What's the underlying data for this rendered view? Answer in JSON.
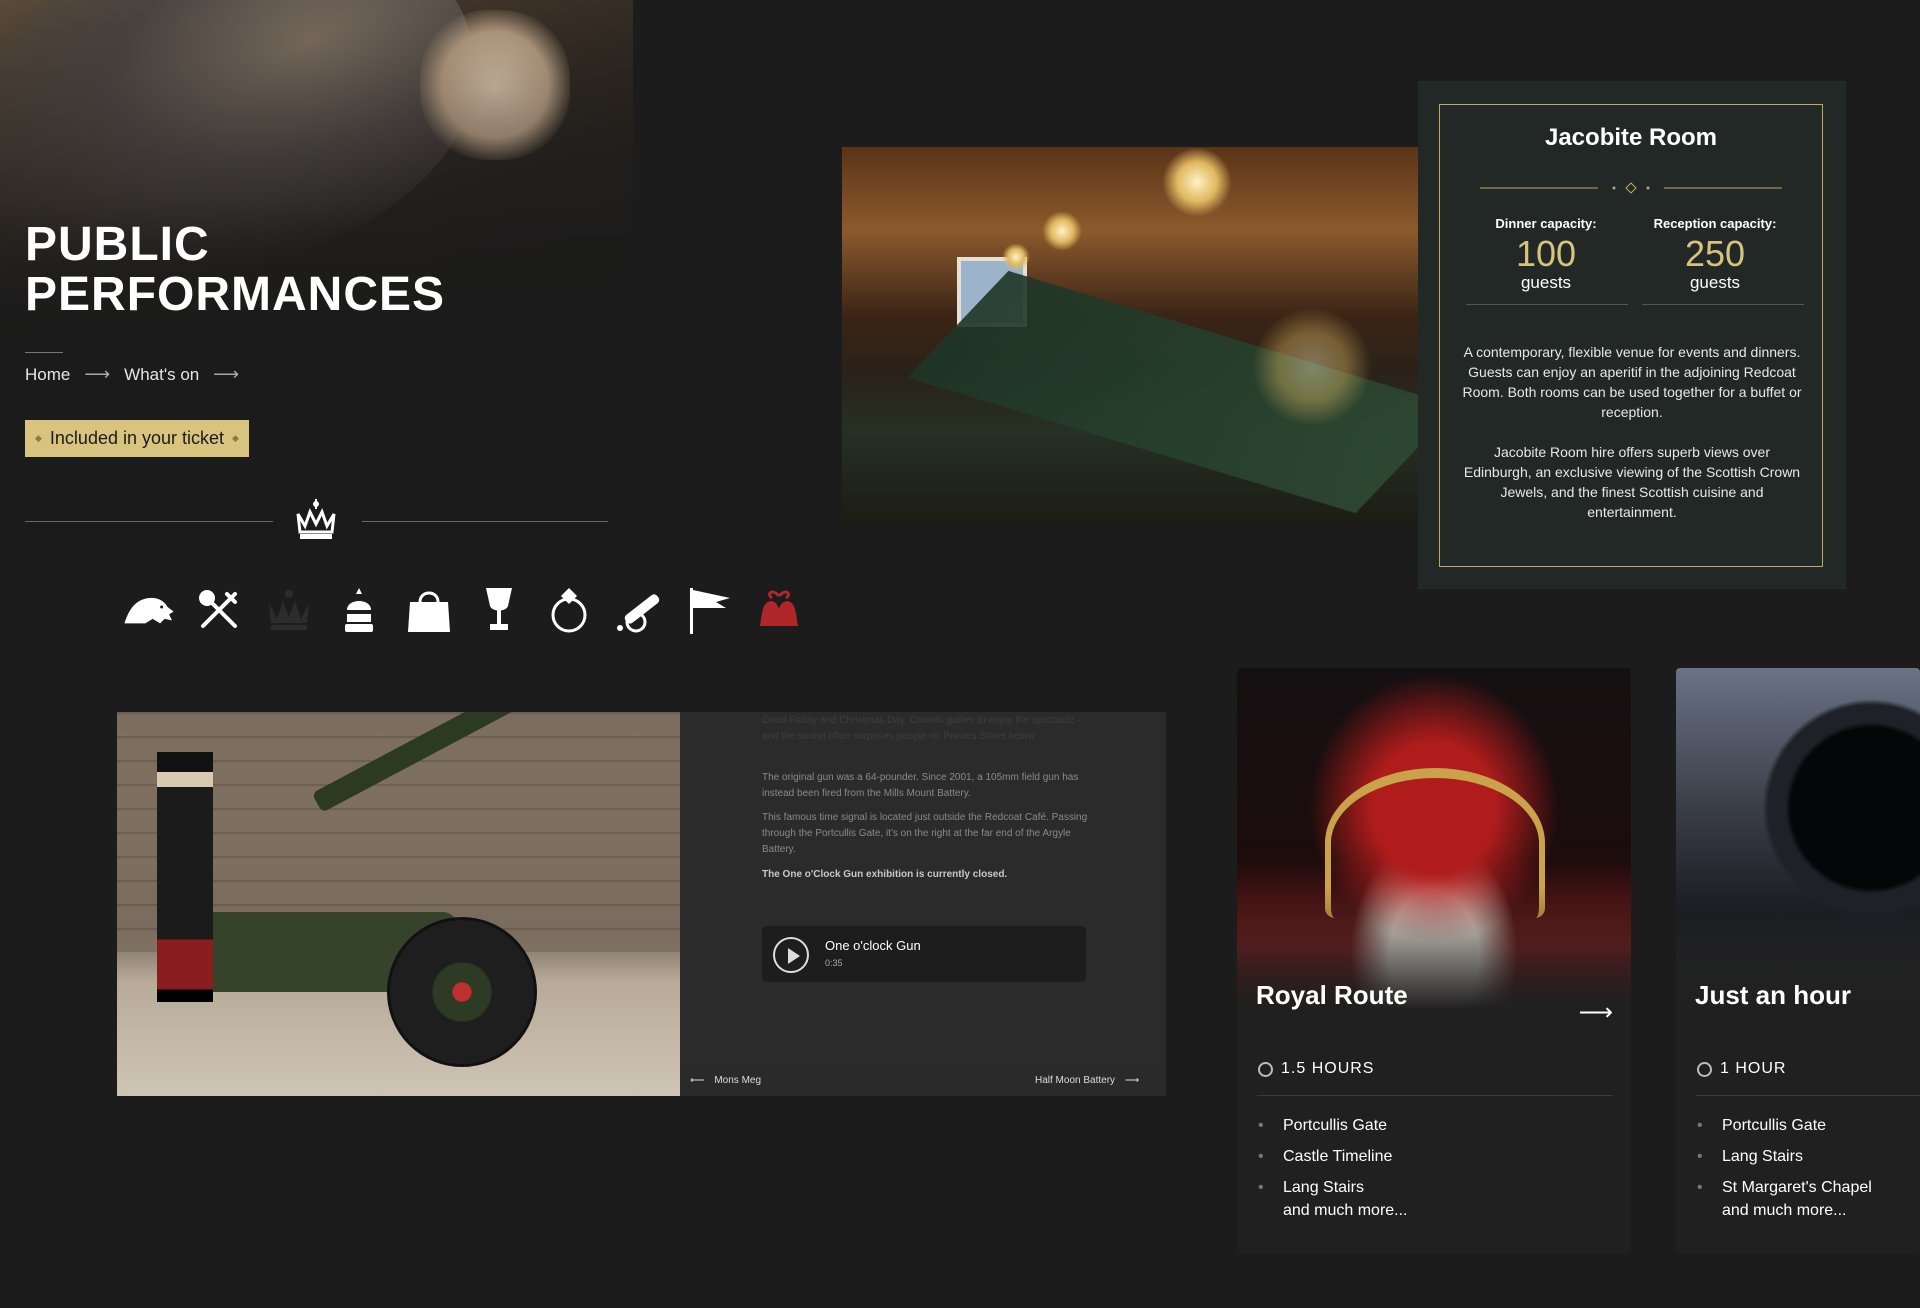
{
  "hero": {
    "title_line1": "PUBLIC",
    "title_line2": "PERFORMANCES",
    "breadcrumb": [
      "Home",
      "What's on"
    ],
    "ticket_badge": "Included in your ticket"
  },
  "icons": [
    "lion-icon",
    "cutlery-icon",
    "crown-icon",
    "knight-helmet-icon",
    "shopping-bag-icon",
    "goblet-icon",
    "ring-icon",
    "cannon-icon",
    "flag-icon",
    "bells-icon"
  ],
  "colors": {
    "gold": "#d8c47f",
    "accent_red": "#b0262a",
    "panel": "#222826"
  },
  "jacobite": {
    "title": "Jacobite Room",
    "dinner_label": "Dinner capacity:",
    "dinner_value": "100",
    "dinner_unit": "guests",
    "reception_label": "Reception capacity:",
    "reception_value": "250",
    "reception_unit": "guests",
    "para1": "A contemporary, flexible venue for events and dinners. Guests can enjoy an aperitif in the adjoining Redcoat Room. Both rooms can be used together for a buffet or reception.",
    "para2": "Jacobite Room hire offers superb views over Edinburgh, an exclusive viewing of the Scottish Crown Jewels, and the finest Scottish cuisine and entertainment."
  },
  "gun": {
    "text_faded": "Good Friday and Christmas Day. Crowds gather to enjoy the spectacle – and the sound often surprises people on Princes Street below.",
    "text_2": "The original gun was a 64-pounder. Since 2001, a 105mm field gun has instead been fired from the Mills Mount Battery.",
    "text_3": "This famous time signal is located just outside the Redcoat Café. Passing through the Portcullis Gate, it's on the right at the far end of the Argyle Battery.",
    "text_closed": "The One o'Clock Gun exhibition is currently closed.",
    "audio_title": "One o'clock Gun",
    "audio_duration": "0:35",
    "nav_prev": "Mons Meg",
    "nav_next": "Half Moon Battery"
  },
  "cards": [
    {
      "title": "Royal Route",
      "duration": "1.5 HOURS",
      "stops": [
        "Portcullis Gate",
        "Castle Timeline",
        "Lang Stairs"
      ],
      "more": "and much more..."
    },
    {
      "title": "Just an hour",
      "duration": "1 HOUR",
      "stops": [
        "Portcullis Gate",
        "Lang Stairs",
        "St Margaret's Chapel"
      ],
      "more": "and much more..."
    }
  ]
}
